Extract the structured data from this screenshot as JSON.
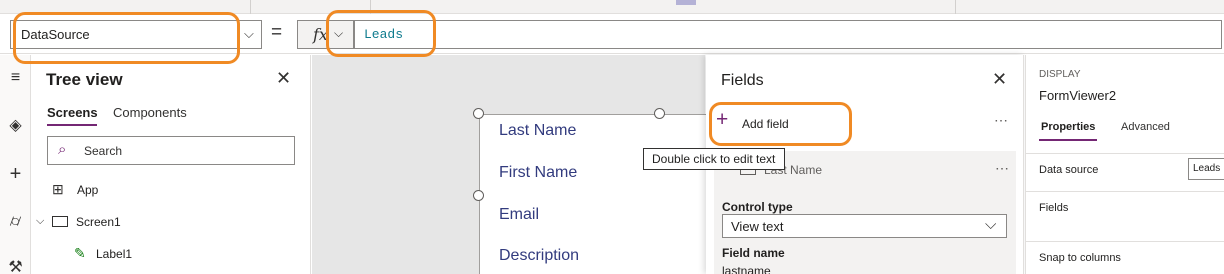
{
  "formula_bar": {
    "property": "DataSource",
    "equals": "=",
    "fx": "fx",
    "formula": "Leads"
  },
  "rail": {
    "icons": [
      "hamburger-icon",
      "layers-icon",
      "plus-icon",
      "database-icon",
      "tools-icon"
    ]
  },
  "tree_view": {
    "title": "Tree view",
    "tabs": [
      "Screens",
      "Components"
    ],
    "search_placeholder": "Search",
    "items": [
      {
        "label": "App",
        "icon": "app-icon"
      },
      {
        "label": "Screen1",
        "icon": "screen-icon"
      },
      {
        "label": "Label1",
        "icon": "label-icon"
      }
    ]
  },
  "canvas": {
    "form_fields": [
      "Last Name",
      "First Name",
      "Email",
      "Description"
    ]
  },
  "fields_panel": {
    "title": "Fields",
    "add_field": "Add field",
    "field": {
      "name": "Last Name",
      "control_type_label": "Control type",
      "control_type_value": "View text",
      "field_name_label": "Field name",
      "field_name_value": "lastname"
    }
  },
  "tooltip": "Double click to edit text",
  "properties_panel": {
    "kind": "DISPLAY",
    "name": "FormViewer2",
    "tabs": [
      "Properties",
      "Advanced"
    ],
    "rows": [
      {
        "label": "Data source",
        "value": "Leads"
      },
      {
        "label": "Fields"
      },
      {
        "label": "Snap to columns"
      }
    ]
  },
  "colors": {
    "accent": "#742774",
    "annotation": "#f08a24",
    "formula_text": "#0f7b8e",
    "form_label": "#323b7e"
  }
}
